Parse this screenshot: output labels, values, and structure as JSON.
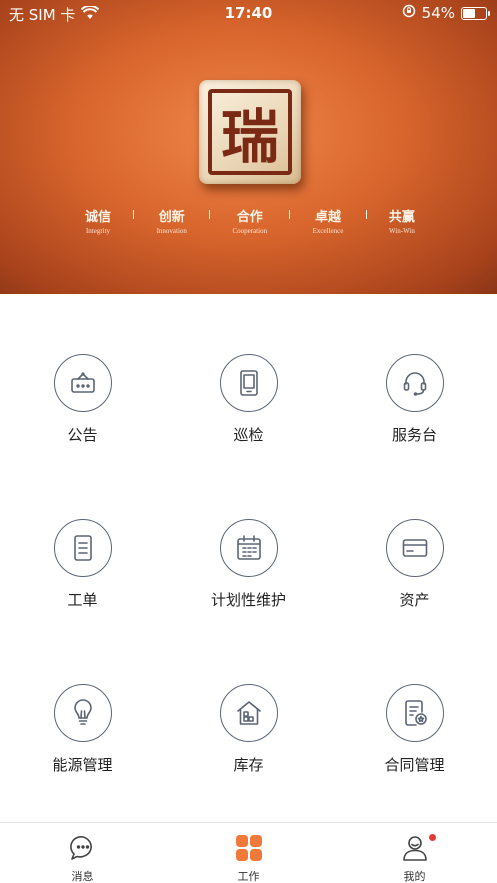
{
  "status_bar": {
    "carrier": "无 SIM 卡",
    "time": "17:40",
    "battery_percent": "54%",
    "battery_level": 0.54
  },
  "banner": {
    "logo_char": "瑞",
    "values": [
      {
        "cn": "诚信",
        "en": "Integrity"
      },
      {
        "cn": "创新",
        "en": "Innovation"
      },
      {
        "cn": "合作",
        "en": "Cooperation"
      },
      {
        "cn": "卓越",
        "en": "Excellence"
      },
      {
        "cn": "共赢",
        "en": "Win-Win"
      }
    ]
  },
  "grid": {
    "items": [
      {
        "label": "公告",
        "icon": "announcement-icon"
      },
      {
        "label": "巡检",
        "icon": "tablet-icon"
      },
      {
        "label": "服务台",
        "icon": "headset-icon"
      },
      {
        "label": "工单",
        "icon": "document-icon"
      },
      {
        "label": "计划性维护",
        "icon": "calendar-icon"
      },
      {
        "label": "资产",
        "icon": "card-icon"
      },
      {
        "label": "能源管理",
        "icon": "lightbulb-icon"
      },
      {
        "label": "库存",
        "icon": "warehouse-icon"
      },
      {
        "label": "合同管理",
        "icon": "contract-icon"
      }
    ]
  },
  "tabbar": {
    "tabs": [
      {
        "label": "消息",
        "icon": "chat-icon",
        "active": false
      },
      {
        "label": "工作",
        "icon": "grid-icon",
        "active": true
      },
      {
        "label": "我的",
        "icon": "user-icon",
        "active": false,
        "badge": true
      }
    ]
  },
  "colors": {
    "accent": "#ef7a3c",
    "icon_stroke": "#5b6573",
    "badge": "#e53935"
  }
}
